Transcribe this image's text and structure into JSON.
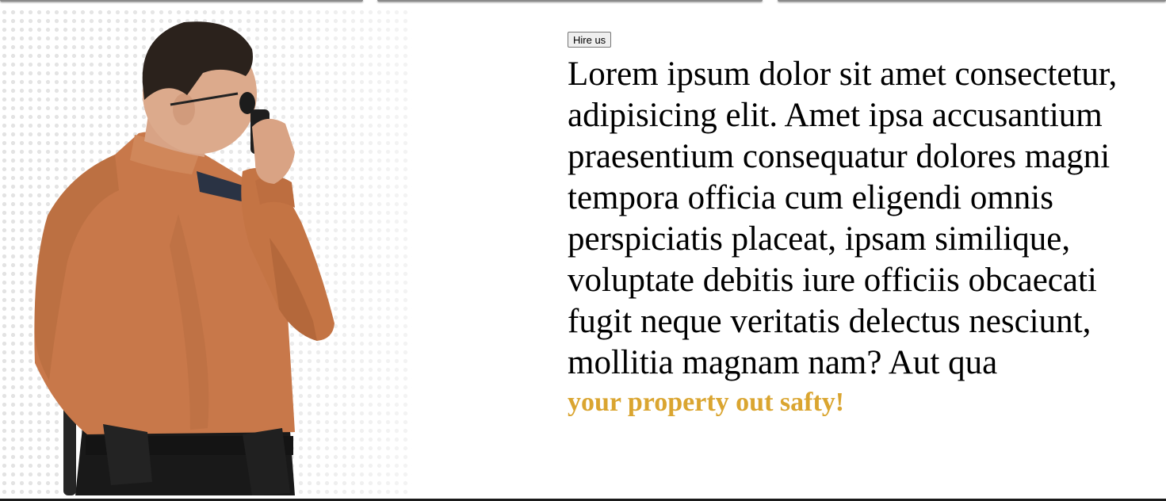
{
  "hero": {
    "image_alt": "Security guard in orange uniform shirt speaking into a walkie-talkie",
    "icon": "security-guard-image"
  },
  "cta": {
    "hire_label": "Hire us"
  },
  "main": {
    "lead_text": "Lorem ipsum dolor sit amet consectetur, adipisicing elit. Amet ipsa accusantium praesentium consequatur dolores magni tempora officia cum eligendi omnis perspiciatis placeat, ipsam similique, voluptate debitis iure officiis obcaecati fugit neque veritatis delectus nesciunt, mollitia magnam nam? Aut qua",
    "tagline": "your property out safty!"
  },
  "colors": {
    "tagline": "#daa530",
    "shirt": "#c8784a"
  }
}
